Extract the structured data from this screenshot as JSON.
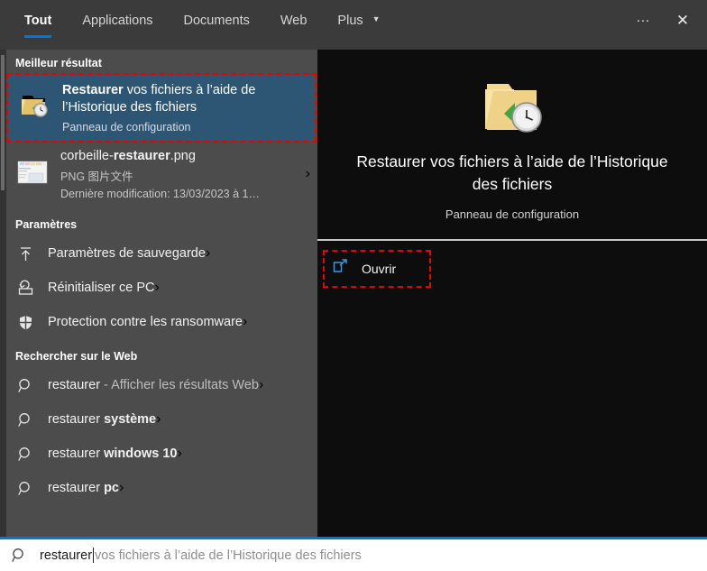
{
  "tabs": [
    {
      "label": "Tout",
      "active": true
    },
    {
      "label": "Applications",
      "active": false
    },
    {
      "label": "Documents",
      "active": false
    },
    {
      "label": "Web",
      "active": false
    },
    {
      "label": "Plus",
      "active": false,
      "caret": "▼"
    }
  ],
  "window_controls": {
    "more_label": "···",
    "close_label": "✕"
  },
  "sections": {
    "best_result_title": "Meilleur résultat",
    "settings_title": "Paramètres",
    "web_title": "Rechercher sur le Web"
  },
  "best_result": {
    "title_bold": "Restaurer",
    "title_rest": " vos fichiers à l’aide de l’Historique des fichiers",
    "caption": "Panneau de configuration",
    "icon": "folder-history-icon",
    "highlight_color": "#ee0000",
    "selected_bg": "#2d5574"
  },
  "file_result": {
    "name_prefix": "corbeille-",
    "name_bold": "restaurer",
    "name_suffix": ".png",
    "type": "PNG 图片文件",
    "modified": "Dernière modification: 13/03/2023 à 1…",
    "chevron": "›"
  },
  "settings_items": [
    {
      "label": "Paramètres de sauvegarde",
      "icon": "backup-upload-icon",
      "chevron": "›"
    },
    {
      "label": "Réinitialiser ce PC",
      "icon": "reset-pc-icon",
      "chevron": "›"
    },
    {
      "label": "Protection contre les ransomware",
      "icon": "shield-icon",
      "chevron": "›"
    }
  ],
  "web_items": [
    {
      "query": "restaurer",
      "bold": "",
      "suffix": " - Afficher les résultats Web",
      "icon": "search-icon",
      "chevron": "›"
    },
    {
      "query": "restaurer ",
      "bold": "système",
      "suffix": "",
      "icon": "search-icon",
      "chevron": "›"
    },
    {
      "query": "restaurer ",
      "bold": "windows 10",
      "suffix": "",
      "icon": "search-icon",
      "chevron": "›"
    },
    {
      "query": "restaurer ",
      "bold": "pc",
      "suffix": "",
      "icon": "search-icon",
      "chevron": "›"
    }
  ],
  "preview": {
    "icon": "folder-history-large-icon",
    "title": "Restaurer vos fichiers à l’aide de l’Historique des fichiers",
    "subtitle": "Panneau de configuration",
    "open_label": "Ouvrir",
    "open_icon": "open-external-icon",
    "open_highlight_color": "#ee0000"
  },
  "search": {
    "icon": "search-icon",
    "typed": "restaurer",
    "suggestion": " vos fichiers à l’aide de l’Historique des fichiers",
    "accent": "#0078d4"
  }
}
